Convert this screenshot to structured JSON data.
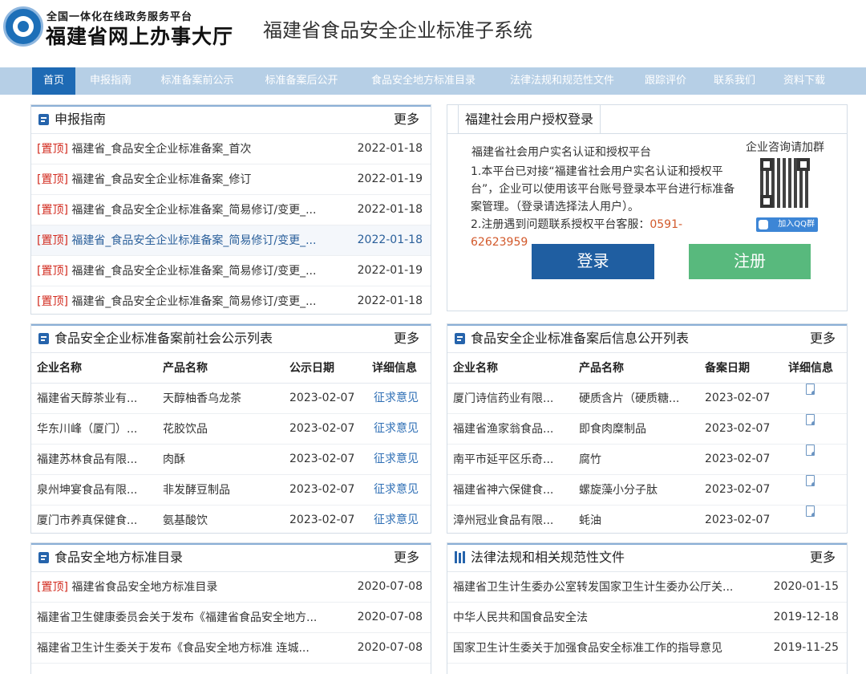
{
  "header": {
    "logo_sub": "全国一体化在线政务服务平台",
    "logo_main": "福建省网上办事大厅",
    "system_title": "福建省食品安全企业标准子系统"
  },
  "nav": [
    "首页",
    "申报指南",
    "标准备案前公示",
    "标准备案后公开",
    "食品安全地方标准目录",
    "法律法规和规范性文件",
    "跟踪评价",
    "联系我们",
    "资料下载"
  ],
  "guide": {
    "title": "申报指南",
    "more": "更多",
    "items": [
      {
        "tag": "[置顶]",
        "text": "福建省_食品安全企业标准备案_首次",
        "date": "2022-01-18"
      },
      {
        "tag": "[置顶]",
        "text": "福建省_食品安全企业标准备案_修订",
        "date": "2022-01-19"
      },
      {
        "tag": "[置顶]",
        "text": "福建省_食品安全企业标准备案_简易修订/变更_...",
        "date": "2022-01-18"
      },
      {
        "tag": "[置顶]",
        "text": "福建省_食品安全企业标准备案_简易修订/变更_...",
        "date": "2022-01-18"
      },
      {
        "tag": "[置顶]",
        "text": "福建省_食品安全企业标准备案_简易修订/变更_...",
        "date": "2022-01-19"
      },
      {
        "tag": "[置顶]",
        "text": "福建省_食品安全企业标准备案_简易修订/变更_...",
        "date": "2022-01-18"
      }
    ]
  },
  "login": {
    "tab": "福建社会用户授权登录",
    "platform_title": "福建省社会用户实名认证和授权平台",
    "desc1": "1.本平台已对接“福建省社会用户实名认证和授权平台”，企业可以使用该平台账号登录本平台进行标准备案管理。（登录请选择法人用户）。",
    "desc2": "2.注册遇到问题联系授权平台客服：",
    "phone": "0591-62623959",
    "qq_label": "企业咨询请加群",
    "qq_button": "加入QQ群",
    "login_button": "登录",
    "register_button": "注册"
  },
  "pre_publicity": {
    "title": "食品安全企业标准备案前社会公示列表",
    "more": "更多",
    "columns": [
      "企业名称",
      "产品名称",
      "公示日期",
      "详细信息"
    ],
    "rows": [
      {
        "company": "福建省天醇茶业有...",
        "product": "天醇柚香乌龙茶",
        "date": "2023-02-07",
        "detail": "征求意见"
      },
      {
        "company": "华东川峰（厦门）...",
        "product": "花胶饮品",
        "date": "2023-02-07",
        "detail": "征求意见"
      },
      {
        "company": "福建苏林食品有限...",
        "product": "肉酥",
        "date": "2023-02-07",
        "detail": "征求意见"
      },
      {
        "company": "泉州坤宴食品有限...",
        "product": "非发酵豆制品",
        "date": "2023-02-07",
        "detail": "征求意见"
      },
      {
        "company": "厦门市养真保健食...",
        "product": "氨基酸饮",
        "date": "2023-02-07",
        "detail": "征求意见"
      }
    ]
  },
  "post_publicity": {
    "title": "食品安全企业标准备案后信息公开列表",
    "more": "更多",
    "columns": [
      "企业名称",
      "产品名称",
      "备案日期",
      "详细信息"
    ],
    "rows": [
      {
        "company": "厦门诗信药业有限...",
        "product": "硬质含片（硬质糖...",
        "date": "2023-02-07"
      },
      {
        "company": "福建省渔家翁食品...",
        "product": "即食肉糜制品",
        "date": "2023-02-07"
      },
      {
        "company": "南平市延平区乐奇...",
        "product": "腐竹",
        "date": "2023-02-07"
      },
      {
        "company": "福建省神六保健食...",
        "product": "螺旋藻小分子肽",
        "date": "2023-02-07"
      },
      {
        "company": "漳州冠业食品有限...",
        "product": "蚝油",
        "date": "2023-02-07"
      }
    ]
  },
  "local_standards": {
    "title": "食品安全地方标准目录",
    "more": "更多",
    "items": [
      {
        "tag": "[置顶]",
        "text": "福建省食品安全地方标准目录",
        "date": "2020-07-08"
      },
      {
        "tag": "",
        "text": "福建省卫生健康委员会关于发布《福建省食品安全地方...",
        "date": "2020-07-08"
      },
      {
        "tag": "",
        "text": "福建省卫生计生委关于发布《食品安全地方标准 连城...",
        "date": "2020-07-08"
      }
    ]
  },
  "laws": {
    "title": "法律法规和相关规范性文件",
    "more": "更多",
    "items": [
      {
        "text": "福建省卫生计生委办公室转发国家卫生计生委办公厅关...",
        "date": "2020-01-15"
      },
      {
        "text": "中华人民共和国食品安全法",
        "date": "2019-12-18"
      },
      {
        "text": "国家卫生计生委关于加强食品安全标准工作的指导意见",
        "date": "2019-11-25"
      }
    ]
  },
  "colors": {
    "nav_bg": "#b6cfe6",
    "nav_active": "#1e6ab4",
    "tag_red": "#d22a1e",
    "link_blue": "#2f6fb5",
    "login_btn": "#1f5ea1",
    "register_btn": "#58b97d"
  }
}
